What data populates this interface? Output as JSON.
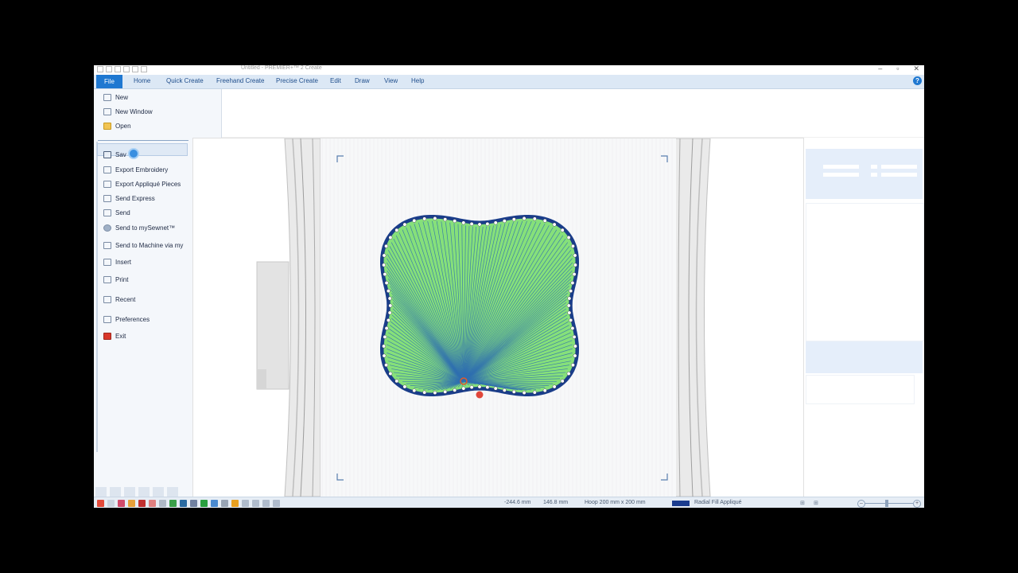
{
  "window": {
    "title": "Untitled - PREMIER+™ 2 Create",
    "min_icon": "minimize-icon",
    "max_icon": "maximize-icon",
    "close_icon": "close-icon",
    "min_glyph": "–",
    "max_glyph": "▫",
    "close_glyph": "✕"
  },
  "ribbon": {
    "tabs": [
      "File",
      "Home",
      "Quick Create",
      "Freehand Create",
      "Precise Create",
      "Edit",
      "Draw",
      "View",
      "Help"
    ],
    "help_glyph": "?"
  },
  "file_menu": {
    "items": [
      {
        "label": "New",
        "icon": "new-document-icon"
      },
      {
        "label": "New Window",
        "icon": "new-window-icon"
      },
      {
        "label": "Open",
        "icon": "open-folder-icon"
      },
      {
        "label": "Save",
        "icon": "save-icon"
      },
      {
        "label": "Export Embroidery",
        "icon": "export-embroidery-icon"
      },
      {
        "label": "Export Appliqué Pieces",
        "icon": "export-applique-icon"
      },
      {
        "label": "Send Express",
        "icon": "send-express-icon"
      },
      {
        "label": "Send",
        "icon": "send-icon"
      },
      {
        "label": "Send to mySewnet™",
        "icon": "cloud-icon"
      },
      {
        "label": "Send to Machine via my",
        "icon": "machine-icon"
      },
      {
        "label": "Insert",
        "icon": "insert-icon"
      },
      {
        "label": "Print",
        "icon": "print-icon"
      },
      {
        "label": "Recent",
        "icon": "recent-icon"
      },
      {
        "label": "Preferences",
        "icon": "preferences-icon"
      },
      {
        "label": "Exit",
        "icon": "exit-icon"
      }
    ],
    "save_partial_label": "Sav"
  },
  "status_bar": {
    "x_coord": "-244.6 mm",
    "y_coord": "146.8 mm",
    "hoop": "Hoop 200 mm x 200 mm",
    "thread_color": "#1b3c8f",
    "thread_label": "Radial Fill Appliqué",
    "zoom_minus": "–",
    "zoom_plus": "+"
  },
  "design": {
    "fill_color": "#86e07a",
    "line_color": "#2f6fb0",
    "border_color": "#1a3d8a",
    "hoop_color": "#d8d8d8"
  }
}
